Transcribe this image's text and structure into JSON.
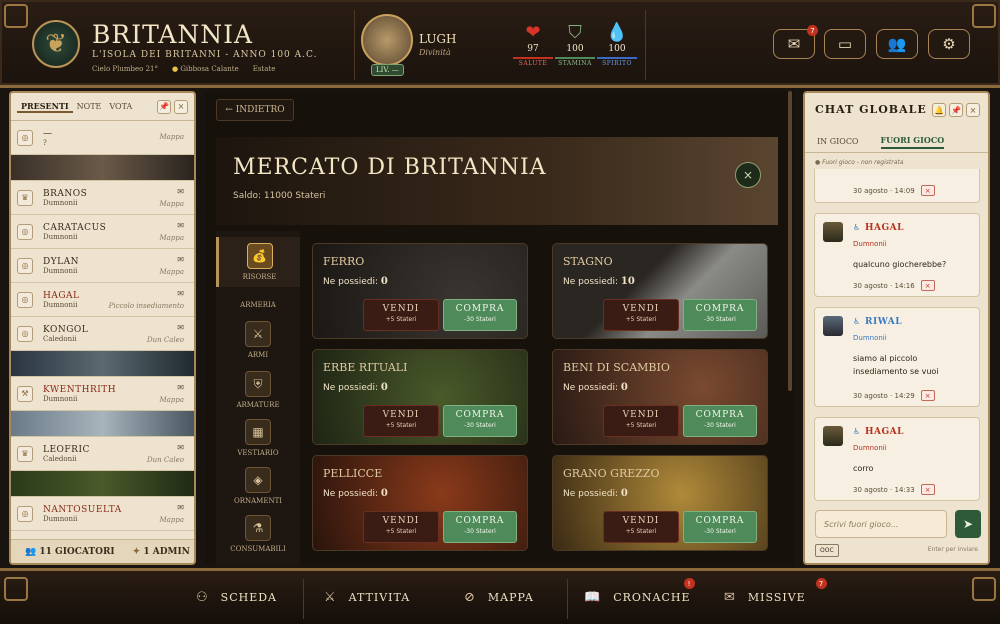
{
  "header": {
    "title": "BRITANNIA",
    "subtitle": "L'ISOLA DEI BRITANNI - ANNO 100 A.C.",
    "weather": "Cielo Plumbeo 21°",
    "moon": "Gibbosa Calante",
    "season": "Estate"
  },
  "profile": {
    "name": "LUGH",
    "role": "Divinità",
    "level": "LIV. —"
  },
  "stats": [
    {
      "label": "SALUTE",
      "value": "97",
      "icon": "heart-icon",
      "color": "#c2321f"
    },
    {
      "label": "STAMINA",
      "value": "100",
      "icon": "shield-icon",
      "color": "#4f8a5a"
    },
    {
      "label": "SPIRITO",
      "value": "100",
      "icon": "drop-icon",
      "color": "#3a6ac2"
    }
  ],
  "top_actions": {
    "mail_badge": "7"
  },
  "left_panel": {
    "tabs": [
      "PRESENTI",
      "NOTE",
      "VOTA"
    ],
    "rows": [
      {
        "name": "—",
        "tribe": "?",
        "place": "Mappa",
        "env": ""
      },
      {
        "name": "BRANOS",
        "tribe": "Dumnonii",
        "place": "Mappa",
        "env": "✉"
      },
      {
        "name": "CARATACUS",
        "tribe": "Dumnonii",
        "place": "Mappa",
        "env": "✉"
      },
      {
        "name": "DYLAN",
        "tribe": "Dumnonii",
        "place": "Mappa",
        "env": "✉"
      },
      {
        "name": "HAGAL",
        "tribe": "Dumnonii",
        "place": "Piccolo insediamento",
        "env": "✉"
      },
      {
        "name": "KONGOL",
        "tribe": "Caledonii",
        "place": "Dun Caleo",
        "env": "✉"
      },
      {
        "name": "KWENTHRITH",
        "tribe": "Dumnonii",
        "place": "Mappa",
        "env": "✉"
      },
      {
        "name": "LEOFRIC",
        "tribe": "Caledonii",
        "place": "Dun Caleo",
        "env": "✉"
      },
      {
        "name": "NANTOSUELTA",
        "tribe": "Dumnonii",
        "place": "Mappa",
        "env": "✉"
      }
    ],
    "players": "11 GIOCATORI",
    "admins": "1 ADMIN"
  },
  "market": {
    "back": "← INDIETRO",
    "title": "MERCATO DI BRITANNIA",
    "balance": "Saldo: 11000 Stateri",
    "categories": [
      {
        "label": "RISORSE",
        "icon": "money-bag-icon"
      },
      {
        "label": "ARMERIA",
        "icon": ""
      },
      {
        "label": "ARMI",
        "icon": "swords-icon"
      },
      {
        "label": "ARMATURE",
        "icon": "armor-icon"
      },
      {
        "label": "VESTIARIO",
        "icon": "clothing-icon"
      },
      {
        "label": "ORNAMENTI",
        "icon": "ornament-icon"
      },
      {
        "label": "CONSUMABILI",
        "icon": "potion-icon"
      }
    ],
    "owned_label": "Ne possiedi:",
    "sell_label": "VENDI",
    "buy_label": "COMPRA",
    "sell_price": "+5 Stateri",
    "buy_price": "-30 Stateri",
    "items": [
      {
        "name": "FERRO",
        "owned": "0",
        "bg": "#2a2622"
      },
      {
        "name": "STAGNO",
        "owned": "10",
        "bg": "#5a5a58"
      },
      {
        "name": "ERBE RITUALI",
        "owned": "0",
        "bg": "#2f3a22"
      },
      {
        "name": "BENI DI SCAMBIO",
        "owned": "0",
        "bg": "#4a2e22"
      },
      {
        "name": "PELLICCE",
        "owned": "0",
        "bg": "#5a2a1a"
      },
      {
        "name": "GRANO GREZZO",
        "owned": "0",
        "bg": "#6a5428"
      }
    ]
  },
  "chat": {
    "title": "CHAT GLOBALE",
    "tabs": [
      "IN GIOCO",
      "FUORI GIOCO"
    ],
    "note": "● Fuori gioco - non registrata",
    "messages": [
      {
        "name": "",
        "tribe": "",
        "text": "",
        "time": "30 agosto · 14:09"
      },
      {
        "name": "HAGAL",
        "tribe": "Dumnonii",
        "text": "qualcuno giocherebbe?",
        "time": "30 agosto · 14:16",
        "color": "#b8321f"
      },
      {
        "name": "RIWAL",
        "tribe": "Dumnonii",
        "text": "siamo al piccolo insediamento se vuoi",
        "time": "30 agosto · 14:29",
        "color": "#3a7ac2"
      },
      {
        "name": "HAGAL",
        "tribe": "Dumnonii",
        "text": "corro",
        "time": "30 agosto · 14:33",
        "color": "#b8321f"
      }
    ],
    "input_placeholder": "Scrivi fuori gioco...",
    "ooc": "OOC",
    "hint": "Enter per inviare"
  },
  "bottom_nav": [
    {
      "label": "SCHEDA",
      "icon": "person-icon"
    },
    {
      "label": "ATTIVITA",
      "icon": "crossed-swords-icon"
    },
    {
      "label": "MAPPA",
      "icon": "compass-icon"
    },
    {
      "label": "CRONACHE",
      "icon": "book-icon",
      "badge": "!"
    },
    {
      "label": "MISSIVE",
      "icon": "mail-icon",
      "badge": "7"
    }
  ]
}
